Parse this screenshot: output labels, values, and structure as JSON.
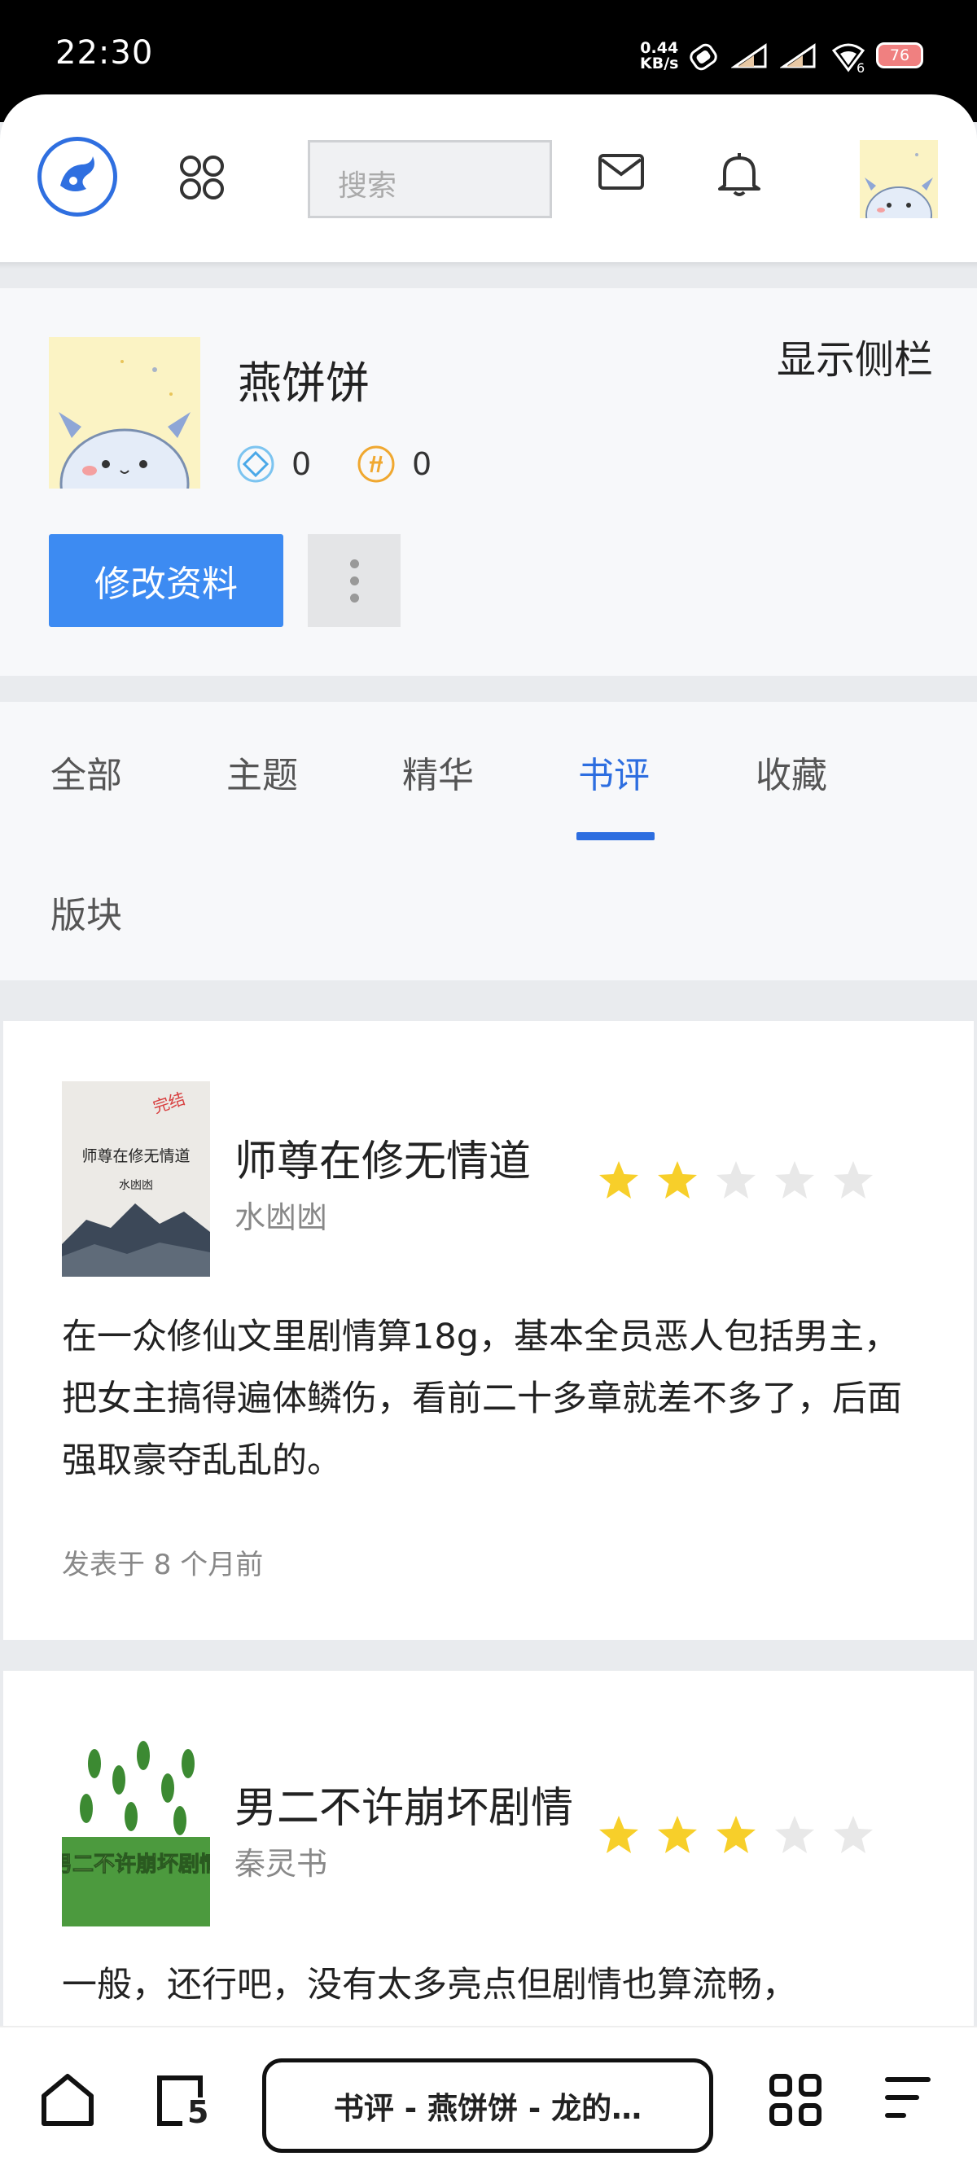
{
  "status_bar": {
    "time": "22:30",
    "net_speed_value": "0.44",
    "net_speed_unit": "KB/s",
    "battery": "76",
    "signal_label": "6"
  },
  "header": {
    "search_placeholder": "搜索"
  },
  "profile": {
    "username": "燕饼饼",
    "toggle_sidebar": "显示侧栏",
    "stat_diamond": "0",
    "stat_coin": "0",
    "edit_button": "修改资料"
  },
  "tabs": [
    {
      "label": "全部",
      "active": false
    },
    {
      "label": "主题",
      "active": false
    },
    {
      "label": "精华",
      "active": false
    },
    {
      "label": "书评",
      "active": true
    },
    {
      "label": "收藏",
      "active": false
    },
    {
      "label": "版块",
      "active": false
    }
  ],
  "reviews": [
    {
      "title": "师尊在修无情道",
      "author": "水凼凼",
      "rating": 2,
      "max_rating": 5,
      "cover_badge": "完结",
      "cover_title": "师尊在修无情道",
      "cover_author": "水凼凼",
      "text": "在一众修仙文里剧情算18g，基本全员恶人包括男主，把女主搞得遍体鳞伤，看前二十多章就差不多了，后面强取豪夺乱乱的。",
      "posted": "发表于 8 个月前"
    },
    {
      "title": "男二不许崩坏剧情",
      "author": "秦灵书",
      "rating": 3,
      "max_rating": 5,
      "cover_title": "男二不许崩坏剧情",
      "text": "一般，还行吧，没有太多亮点但剧情也算流畅，"
    }
  ],
  "bottom_bar": {
    "tab_count": "5",
    "address": "书评 - 燕饼饼 - 龙的…"
  },
  "colors": {
    "accent": "#2d6ee0",
    "button": "#3d8bf2",
    "star_on": "#f7cf2a",
    "star_off": "#e8e8e8"
  }
}
